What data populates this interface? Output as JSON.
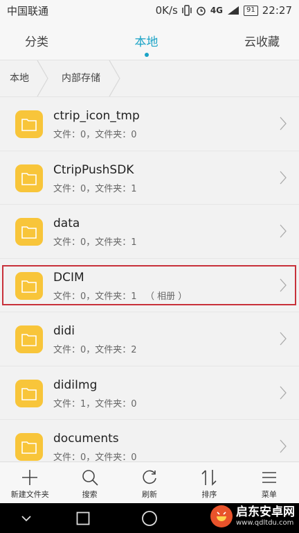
{
  "status": {
    "carrier": "中国联通",
    "speed": "0K/s",
    "network": "4G",
    "battery": "91",
    "time": "22:27"
  },
  "tabs": [
    {
      "label": "分类",
      "active": false
    },
    {
      "label": "本地",
      "active": true
    },
    {
      "label": "云收藏",
      "active": false
    }
  ],
  "breadcrumb": [
    "本地",
    "内部存储"
  ],
  "files": [
    {
      "name": "ctrip_icon_tmp",
      "meta": "文件：0，文件夹：0"
    },
    {
      "name": "CtripPushSDK",
      "meta": "文件：0，文件夹：1"
    },
    {
      "name": "data",
      "meta": "文件：0，文件夹：1"
    },
    {
      "name": "DCIM",
      "meta": "文件：0，文件夹：1   （ 相册 ）"
    },
    {
      "name": "didi",
      "meta": "文件：0，文件夹：2"
    },
    {
      "name": "didiImg",
      "meta": "文件：1，文件夹：0"
    },
    {
      "name": "documents",
      "meta": "文件：0，文件夹：0"
    }
  ],
  "actions": [
    {
      "label": "新建文件夹",
      "icon": "plus-icon"
    },
    {
      "label": "搜索",
      "icon": "search-icon"
    },
    {
      "label": "刷新",
      "icon": "refresh-icon"
    },
    {
      "label": "排序",
      "icon": "sort-icon"
    },
    {
      "label": "菜单",
      "icon": "menu-icon"
    }
  ],
  "watermark": {
    "title": "启东安卓网",
    "url": "www.qdltdu.com"
  },
  "colors": {
    "accent": "#1aa3c6",
    "folder": "#f8c53a",
    "highlight": "#c8313a"
  }
}
